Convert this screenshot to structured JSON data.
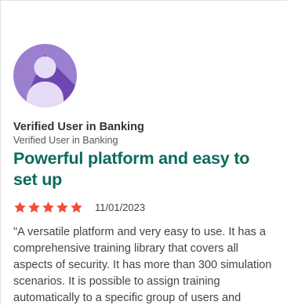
{
  "review": {
    "reviewer_name": "Verified User in Banking",
    "reviewer_role": "Verified User in Banking",
    "title": "Powerful platform and easy to set up",
    "rating": 5,
    "rating_max": 5,
    "date": "11/01/2023",
    "body": "\"A versatile platform and very easy to use. It has a comprehensive training library that covers all aspects of security. It has more than 300 simulation scenarios. It is possible to assign training automatically to a specific group of users and"
  },
  "icons": {
    "avatar": "user-avatar-icon",
    "star": "star-icon"
  },
  "colors": {
    "title": "#0b6b5b",
    "star": "#f04e37",
    "avatar_bg": "#9d7fd0",
    "avatar_figure": "#e6dcf5",
    "avatar_shadow": "#6f47b3"
  }
}
